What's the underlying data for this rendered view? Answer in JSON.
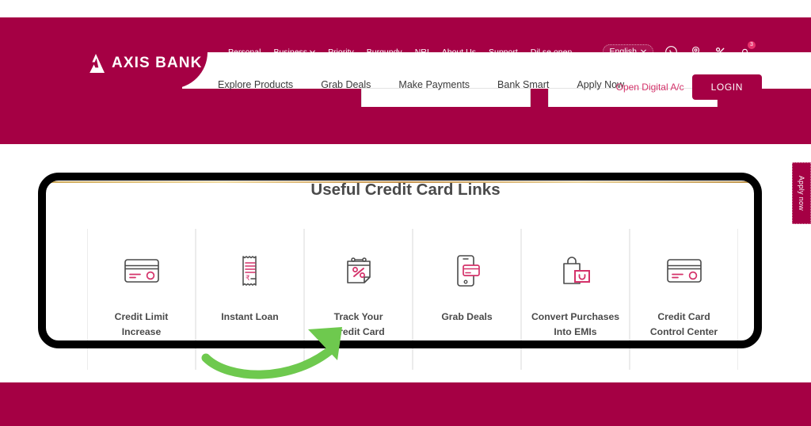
{
  "brand": {
    "name": "AXIS BANK",
    "logo_icon": "axis-bank-logo-icon",
    "maroon": "#a50044",
    "pink": "#d4326a",
    "gold": "#c9a14a",
    "highlight_black": "#000000",
    "arrow_green": "#6ec94e"
  },
  "header": {
    "top_nav": [
      {
        "label": "Personal",
        "has_chevron": false
      },
      {
        "label": "Business",
        "has_chevron": true
      },
      {
        "label": "Priority",
        "has_chevron": false
      },
      {
        "label": "Burgundy",
        "has_chevron": false
      },
      {
        "label": "NRI",
        "has_chevron": false
      },
      {
        "label": "About Us",
        "has_chevron": false
      },
      {
        "label": "Support",
        "has_chevron": false
      },
      {
        "label": "Dil se open",
        "has_chevron": false
      }
    ],
    "language": {
      "label": "English",
      "chevron_icon": "chevron-down-icon"
    },
    "utility_icons": [
      {
        "name": "whatsapp-icon"
      },
      {
        "name": "location-pin-icon"
      },
      {
        "name": "percent-offers-icon"
      },
      {
        "name": "notification-bell-icon",
        "badge": "3"
      }
    ],
    "main_nav": [
      {
        "label": "Explore Products"
      },
      {
        "label": "Grab Deals"
      },
      {
        "label": "Make Payments"
      },
      {
        "label": "Bank Smart"
      },
      {
        "label": "Apply Now"
      }
    ],
    "open_digital_label": "Open Digital A/c",
    "login_label": "LOGIN"
  },
  "side_tab": {
    "label": "Apply now"
  },
  "main": {
    "section_title": "Useful Credit Card Links",
    "tiles": [
      {
        "label": "Credit Limit\nIncrease",
        "line1": "Credit Limit",
        "line2": "Increase",
        "icon": "credit-card-icon"
      },
      {
        "label": "Instant Loan",
        "line1": "Instant Loan",
        "line2": "",
        "icon": "receipt-rupee-icon"
      },
      {
        "label": "Track Your\nCredit Card",
        "line1": "Track Your",
        "line2": "Credit Card",
        "icon": "calendar-percent-icon"
      },
      {
        "label": "Grab Deals",
        "line1": "Grab Deals",
        "line2": "",
        "icon": "mobile-card-icon"
      },
      {
        "label": "Convert Purchases\nInto EMIs",
        "line1": "Convert Purchases",
        "line2": "Into EMIs",
        "icon": "shopping-bag-icon"
      },
      {
        "label": "Credit Card\nControl Center",
        "line1": "Credit Card",
        "line2": "Control Center",
        "icon": "credit-card-icon"
      }
    ]
  },
  "annotations": {
    "highlight_box": {
      "shape": "rounded-rectangle",
      "color": "#000000"
    },
    "arrow": {
      "shape": "curved-arrow",
      "color": "#6ec94e",
      "points_to": "Track Your Credit Card"
    }
  }
}
